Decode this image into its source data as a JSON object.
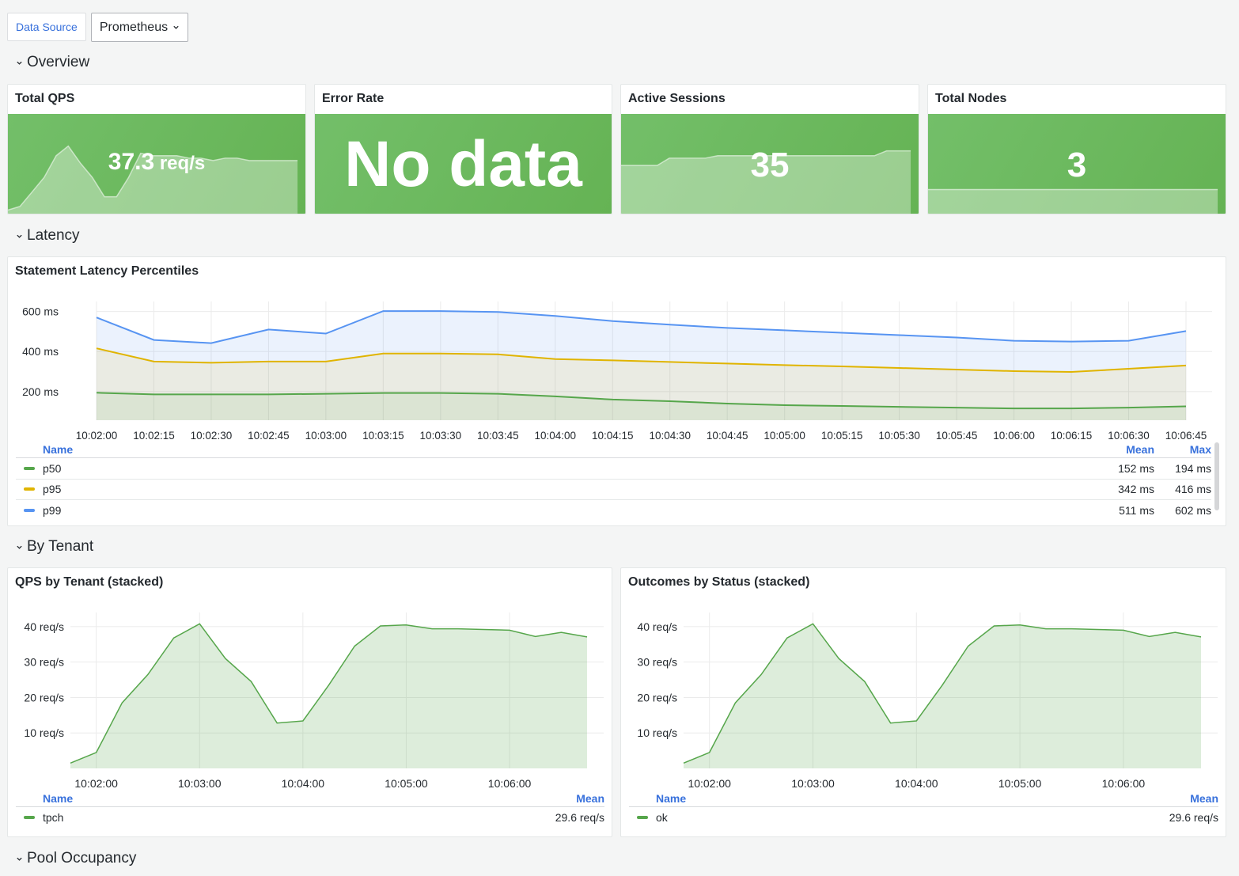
{
  "toolbar": {
    "datasource_label": "Data Source",
    "datasource_value": "Prometheus"
  },
  "rows": {
    "overview": "Overview",
    "latency": "Latency",
    "by_tenant": "By Tenant",
    "pool": "Pool Occupancy"
  },
  "stats": {
    "qps": {
      "title": "Total QPS",
      "value": "37.3",
      "unit": " req/s",
      "spark": [
        3,
        6,
        18,
        30,
        48,
        56,
        42,
        30,
        14,
        14,
        30,
        50,
        48,
        48,
        48,
        46,
        46,
        44,
        46,
        46,
        44,
        44,
        44,
        44,
        44
      ]
    },
    "errors": {
      "title": "Error Rate",
      "value": "No data"
    },
    "sessions": {
      "title": "Active Sessions",
      "value": "35",
      "spark": [
        20,
        20,
        20,
        20,
        23,
        23,
        23,
        23,
        24,
        24,
        24,
        24,
        24,
        24,
        24,
        24,
        24,
        24,
        24,
        24,
        24,
        24,
        26,
        26,
        26
      ]
    },
    "nodes": {
      "title": "Total Nodes",
      "value": "3",
      "spark": [
        3,
        3,
        3,
        3,
        3,
        3,
        3,
        3,
        3,
        3,
        3,
        3,
        3,
        3,
        3,
        3,
        3,
        3,
        3,
        3,
        3,
        3,
        3,
        3,
        3
      ]
    }
  },
  "latency_panel": {
    "title": "Statement Latency Percentiles",
    "legend": {
      "name_header": "Name",
      "mean_header": "Mean",
      "max_header": "Max",
      "rows": [
        {
          "name": "p50",
          "mean": "152 ms",
          "max": "194 ms",
          "color": "#56a64b"
        },
        {
          "name": "p95",
          "mean": "342 ms",
          "max": "416 ms",
          "color": "#e0b400"
        },
        {
          "name": "p99",
          "mean": "511 ms",
          "max": "602 ms",
          "color": "#5794f2"
        }
      ]
    }
  },
  "tenant_panel": {
    "title": "QPS by Tenant (stacked)",
    "legend": {
      "name_header": "Name",
      "mean_header": "Mean",
      "rows": [
        {
          "name": "tpch",
          "mean": "29.6 req/s",
          "color": "#56a64b"
        }
      ]
    }
  },
  "status_panel": {
    "title": "Outcomes by Status (stacked)",
    "legend": {
      "name_header": "Name",
      "mean_header": "Mean",
      "rows": [
        {
          "name": "ok",
          "mean": "29.6 req/s",
          "color": "#56a64b"
        }
      ]
    }
  },
  "chart_data": [
    {
      "type": "line",
      "title": "Statement Latency Percentiles",
      "x": [
        "10:02:00",
        "10:02:15",
        "10:02:30",
        "10:02:45",
        "10:03:00",
        "10:03:15",
        "10:03:30",
        "10:03:45",
        "10:04:00",
        "10:04:15",
        "10:04:30",
        "10:04:45",
        "10:05:00",
        "10:05:15",
        "10:05:30",
        "10:05:45",
        "10:06:00",
        "10:06:15",
        "10:06:30",
        "10:06:45"
      ],
      "yticks": [
        200,
        400,
        600
      ],
      "ylim": [
        57,
        650
      ],
      "y_unit": "ms",
      "fill": true,
      "series": [
        {
          "name": "p50",
          "color": "#56a64b",
          "values": [
            194,
            186,
            186,
            186,
            189,
            193,
            193,
            189,
            176,
            160,
            152,
            140,
            132,
            128,
            124,
            120,
            116,
            116,
            120,
            126
          ]
        },
        {
          "name": "p95",
          "color": "#e0b400",
          "values": [
            416,
            350,
            344,
            350,
            350,
            390,
            390,
            386,
            362,
            356,
            348,
            340,
            332,
            326,
            318,
            310,
            302,
            298,
            314,
            330
          ]
        },
        {
          "name": "p99",
          "color": "#5794f2",
          "values": [
            570,
            458,
            442,
            510,
            490,
            602,
            602,
            598,
            578,
            552,
            534,
            518,
            506,
            494,
            482,
            470,
            454,
            450,
            454,
            502
          ]
        }
      ]
    },
    {
      "type": "area",
      "title": "QPS by Tenant (stacked)",
      "x_ticks": [
        "10:02:00",
        "10:03:00",
        "10:04:00",
        "10:05:00",
        "10:06:00"
      ],
      "yticks": [
        10,
        20,
        30,
        40
      ],
      "y_unit": "req/s",
      "ylim": [
        0,
        44
      ],
      "series": [
        {
          "name": "tpch",
          "color": "#56a64b",
          "x": [
            "10:01:45",
            "10:02:00",
            "10:02:15",
            "10:02:30",
            "10:02:45",
            "10:03:00",
            "10:03:15",
            "10:03:30",
            "10:03:45",
            "10:04:00",
            "10:04:15",
            "10:04:30",
            "10:04:45",
            "10:05:00",
            "10:05:15",
            "10:05:30",
            "10:05:45",
            "10:06:00",
            "10:06:15",
            "10:06:30",
            "10:06:45"
          ],
          "values": [
            1.5,
            4.5,
            18.5,
            26.5,
            36.8,
            40.8,
            31.0,
            24.5,
            12.8,
            13.4,
            23.5,
            34.5,
            40.2,
            40.5,
            39.4,
            39.4,
            39.2,
            39.0,
            37.2,
            38.4,
            37.1
          ]
        }
      ]
    },
    {
      "type": "area",
      "title": "Outcomes by Status (stacked)",
      "x_ticks": [
        "10:02:00",
        "10:03:00",
        "10:04:00",
        "10:05:00",
        "10:06:00"
      ],
      "yticks": [
        10,
        20,
        30,
        40
      ],
      "y_unit": "req/s",
      "ylim": [
        0,
        44
      ],
      "series": [
        {
          "name": "ok",
          "color": "#56a64b",
          "x": [
            "10:01:45",
            "10:02:00",
            "10:02:15",
            "10:02:30",
            "10:02:45",
            "10:03:00",
            "10:03:15",
            "10:03:30",
            "10:03:45",
            "10:04:00",
            "10:04:15",
            "10:04:30",
            "10:04:45",
            "10:05:00",
            "10:05:15",
            "10:05:30",
            "10:05:45",
            "10:06:00",
            "10:06:15",
            "10:06:30",
            "10:06:45"
          ],
          "values": [
            1.5,
            4.5,
            18.5,
            26.5,
            36.8,
            40.8,
            31.0,
            24.5,
            12.8,
            13.4,
            23.5,
            34.5,
            40.2,
            40.5,
            39.4,
            39.4,
            39.2,
            39.0,
            37.2,
            38.4,
            37.1
          ]
        }
      ]
    }
  ]
}
